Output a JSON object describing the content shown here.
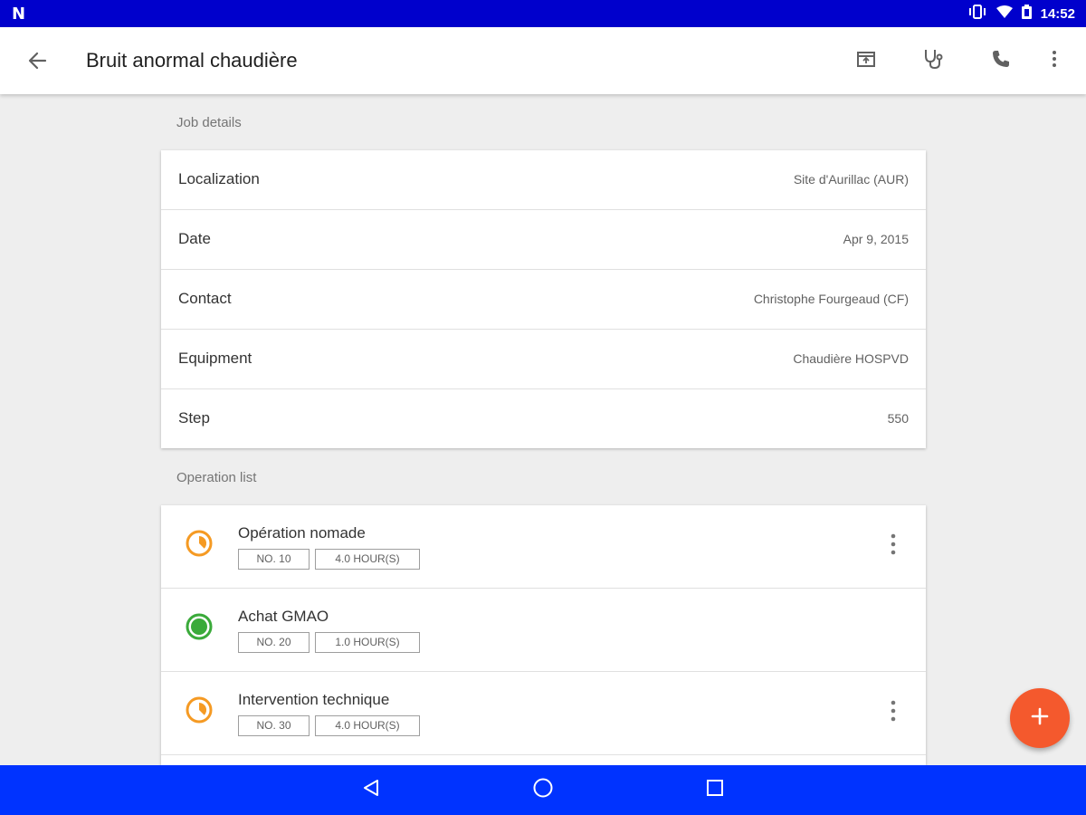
{
  "status_bar": {
    "time": "14:52",
    "icons": [
      "notification-n-icon",
      "vibrate-icon",
      "wifi-icon",
      "battery-icon"
    ]
  },
  "app_bar": {
    "title": "Bruit anormal chaudière",
    "actions": [
      "calendar-icon",
      "stethoscope-icon",
      "phone-icon",
      "more-vert-icon"
    ]
  },
  "job_details": {
    "label": "Job details",
    "rows": [
      {
        "label": "Localization",
        "value": "Site d'Aurillac (AUR)"
      },
      {
        "label": "Date",
        "value": "Apr 9, 2015"
      },
      {
        "label": "Contact",
        "value": "Christophe Fourgeaud (CF)"
      },
      {
        "label": "Equipment",
        "value": "Chaudière HOSPVD"
      },
      {
        "label": "Step",
        "value": "550"
      }
    ]
  },
  "operation_list": {
    "label": "Operation list",
    "items": [
      {
        "name": "Opération nomade",
        "number": "NO. 10",
        "hours": "4.0 HOUR(S)",
        "status": "in-progress",
        "has_menu": true
      },
      {
        "name": "Achat GMAO",
        "number": "NO. 20",
        "hours": "1.0 HOUR(S)",
        "status": "done",
        "has_menu": false
      },
      {
        "name": "Intervention technique",
        "number": "NO. 30",
        "hours": "4.0 HOUR(S)",
        "status": "in-progress",
        "has_menu": true
      }
    ]
  },
  "colors": {
    "status_bar": "#0000cc",
    "nav_bar": "#0033ff",
    "fab": "#f4592d",
    "in_progress": "#f59a23",
    "done": "#3aaa3a"
  }
}
